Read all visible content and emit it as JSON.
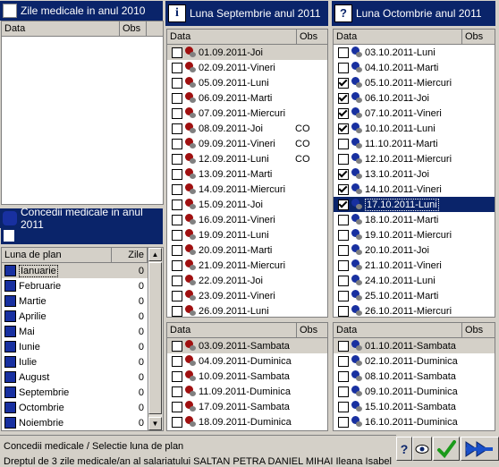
{
  "left": {
    "zile_title": "Zile medicale in anul 2010",
    "zile_cols": [
      "Data",
      "Obs"
    ],
    "concedii_title": "Concedii medicale in anul 2011",
    "luna_cols": [
      "Luna de plan",
      "Zile"
    ],
    "luna_rows": [
      {
        "name": "Ianuarie",
        "zile": "0"
      },
      {
        "name": "Februarie",
        "zile": "0"
      },
      {
        "name": "Martie",
        "zile": "0"
      },
      {
        "name": "Aprilie",
        "zile": "0"
      },
      {
        "name": "Mai",
        "zile": "0"
      },
      {
        "name": "Iunie",
        "zile": "0"
      },
      {
        "name": "Iulie",
        "zile": "0"
      },
      {
        "name": "August",
        "zile": "0"
      },
      {
        "name": "Septembrie",
        "zile": "0"
      },
      {
        "name": "Octombrie",
        "zile": "0"
      },
      {
        "name": "Noiembrie",
        "zile": "0"
      }
    ]
  },
  "sept": {
    "title": "Luna Septembrie anul 2011",
    "cols": [
      "Data",
      "Obs"
    ],
    "days": [
      {
        "date": "01.09.2011-Joi",
        "obs": "",
        "checked": false
      },
      {
        "date": "02.09.2011-Vineri",
        "obs": "",
        "checked": false
      },
      {
        "date": "05.09.2011-Luni",
        "obs": "",
        "checked": false
      },
      {
        "date": "06.09.2011-Marti",
        "obs": "",
        "checked": false
      },
      {
        "date": "07.09.2011-Miercuri",
        "obs": "",
        "checked": false
      },
      {
        "date": "08.09.2011-Joi",
        "obs": "CO",
        "checked": false
      },
      {
        "date": "09.09.2011-Vineri",
        "obs": "CO",
        "checked": false
      },
      {
        "date": "12.09.2011-Luni",
        "obs": "CO",
        "checked": false
      },
      {
        "date": "13.09.2011-Marti",
        "obs": "",
        "checked": false
      },
      {
        "date": "14.09.2011-Miercuri",
        "obs": "",
        "checked": false
      },
      {
        "date": "15.09.2011-Joi",
        "obs": "",
        "checked": false
      },
      {
        "date": "16.09.2011-Vineri",
        "obs": "",
        "checked": false
      },
      {
        "date": "19.09.2011-Luni",
        "obs": "",
        "checked": false
      },
      {
        "date": "20.09.2011-Marti",
        "obs": "",
        "checked": false
      },
      {
        "date": "21.09.2011-Miercuri",
        "obs": "",
        "checked": false
      },
      {
        "date": "22.09.2011-Joi",
        "obs": "",
        "checked": false
      },
      {
        "date": "23.09.2011-Vineri",
        "obs": "",
        "checked": false
      },
      {
        "date": "26.09.2011-Luni",
        "obs": "",
        "checked": false
      }
    ],
    "weekend_cols": [
      "Data",
      "Obs"
    ],
    "weekend": [
      {
        "date": "03.09.2011-Sambata",
        "obs": "",
        "checked": false
      },
      {
        "date": "04.09.2011-Duminica",
        "obs": "",
        "checked": false
      },
      {
        "date": "10.09.2011-Sambata",
        "obs": "",
        "checked": false
      },
      {
        "date": "11.09.2011-Duminica",
        "obs": "",
        "checked": false
      },
      {
        "date": "17.09.2011-Sambata",
        "obs": "",
        "checked": false
      },
      {
        "date": "18.09.2011-Duminica",
        "obs": "",
        "checked": false
      }
    ]
  },
  "oct": {
    "title": "Luna Octombrie anul 2011",
    "cols": [
      "Data",
      "Obs"
    ],
    "days": [
      {
        "date": "03.10.2011-Luni",
        "obs": "",
        "checked": false
      },
      {
        "date": "04.10.2011-Marti",
        "obs": "",
        "checked": false
      },
      {
        "date": "05.10.2011-Miercuri",
        "obs": "",
        "checked": true
      },
      {
        "date": "06.10.2011-Joi",
        "obs": "",
        "checked": true
      },
      {
        "date": "07.10.2011-Vineri",
        "obs": "",
        "checked": true
      },
      {
        "date": "10.10.2011-Luni",
        "obs": "",
        "checked": true
      },
      {
        "date": "11.10.2011-Marti",
        "obs": "",
        "checked": false
      },
      {
        "date": "12.10.2011-Miercuri",
        "obs": "",
        "checked": false
      },
      {
        "date": "13.10.2011-Joi",
        "obs": "",
        "checked": true
      },
      {
        "date": "14.10.2011-Vineri",
        "obs": "",
        "checked": true
      },
      {
        "date": "17.10.2011-Luni",
        "obs": "",
        "checked": true
      },
      {
        "date": "18.10.2011-Marti",
        "obs": "",
        "checked": false
      },
      {
        "date": "19.10.2011-Miercuri",
        "obs": "",
        "checked": false
      },
      {
        "date": "20.10.2011-Joi",
        "obs": "",
        "checked": false
      },
      {
        "date": "21.10.2011-Vineri",
        "obs": "",
        "checked": false
      },
      {
        "date": "24.10.2011-Luni",
        "obs": "",
        "checked": false
      },
      {
        "date": "25.10.2011-Marti",
        "obs": "",
        "checked": false
      },
      {
        "date": "26.10.2011-Miercuri",
        "obs": "",
        "checked": false
      }
    ],
    "weekend_cols": [
      "Data",
      "Obs"
    ],
    "weekend": [
      {
        "date": "01.10.2011-Sambata",
        "obs": "",
        "checked": false
      },
      {
        "date": "02.10.2011-Duminica",
        "obs": "",
        "checked": false
      },
      {
        "date": "08.10.2011-Sambata",
        "obs": "",
        "checked": false
      },
      {
        "date": "09.10.2011-Duminica",
        "obs": "",
        "checked": false
      },
      {
        "date": "15.10.2011-Sambata",
        "obs": "",
        "checked": false
      },
      {
        "date": "16.10.2011-Duminica",
        "obs": "",
        "checked": false
      }
    ]
  },
  "status": {
    "line1": "Concedii medicale / Selectie luna de plan",
    "line2": "Dreptul de 3 zile medicale/an al salariatului SALTAN PETRA DANIEL MIHAI Ileana Isabel"
  },
  "toolbar": {
    "help_icon": "help-icon",
    "view_icon": "eye-icon",
    "ok_icon": "check-icon",
    "next_icon": "forward-arrows-icon"
  },
  "colors": {
    "titlebar": "#0a246a",
    "selected_row": "#0a246a",
    "face": "#d4d0c8"
  }
}
